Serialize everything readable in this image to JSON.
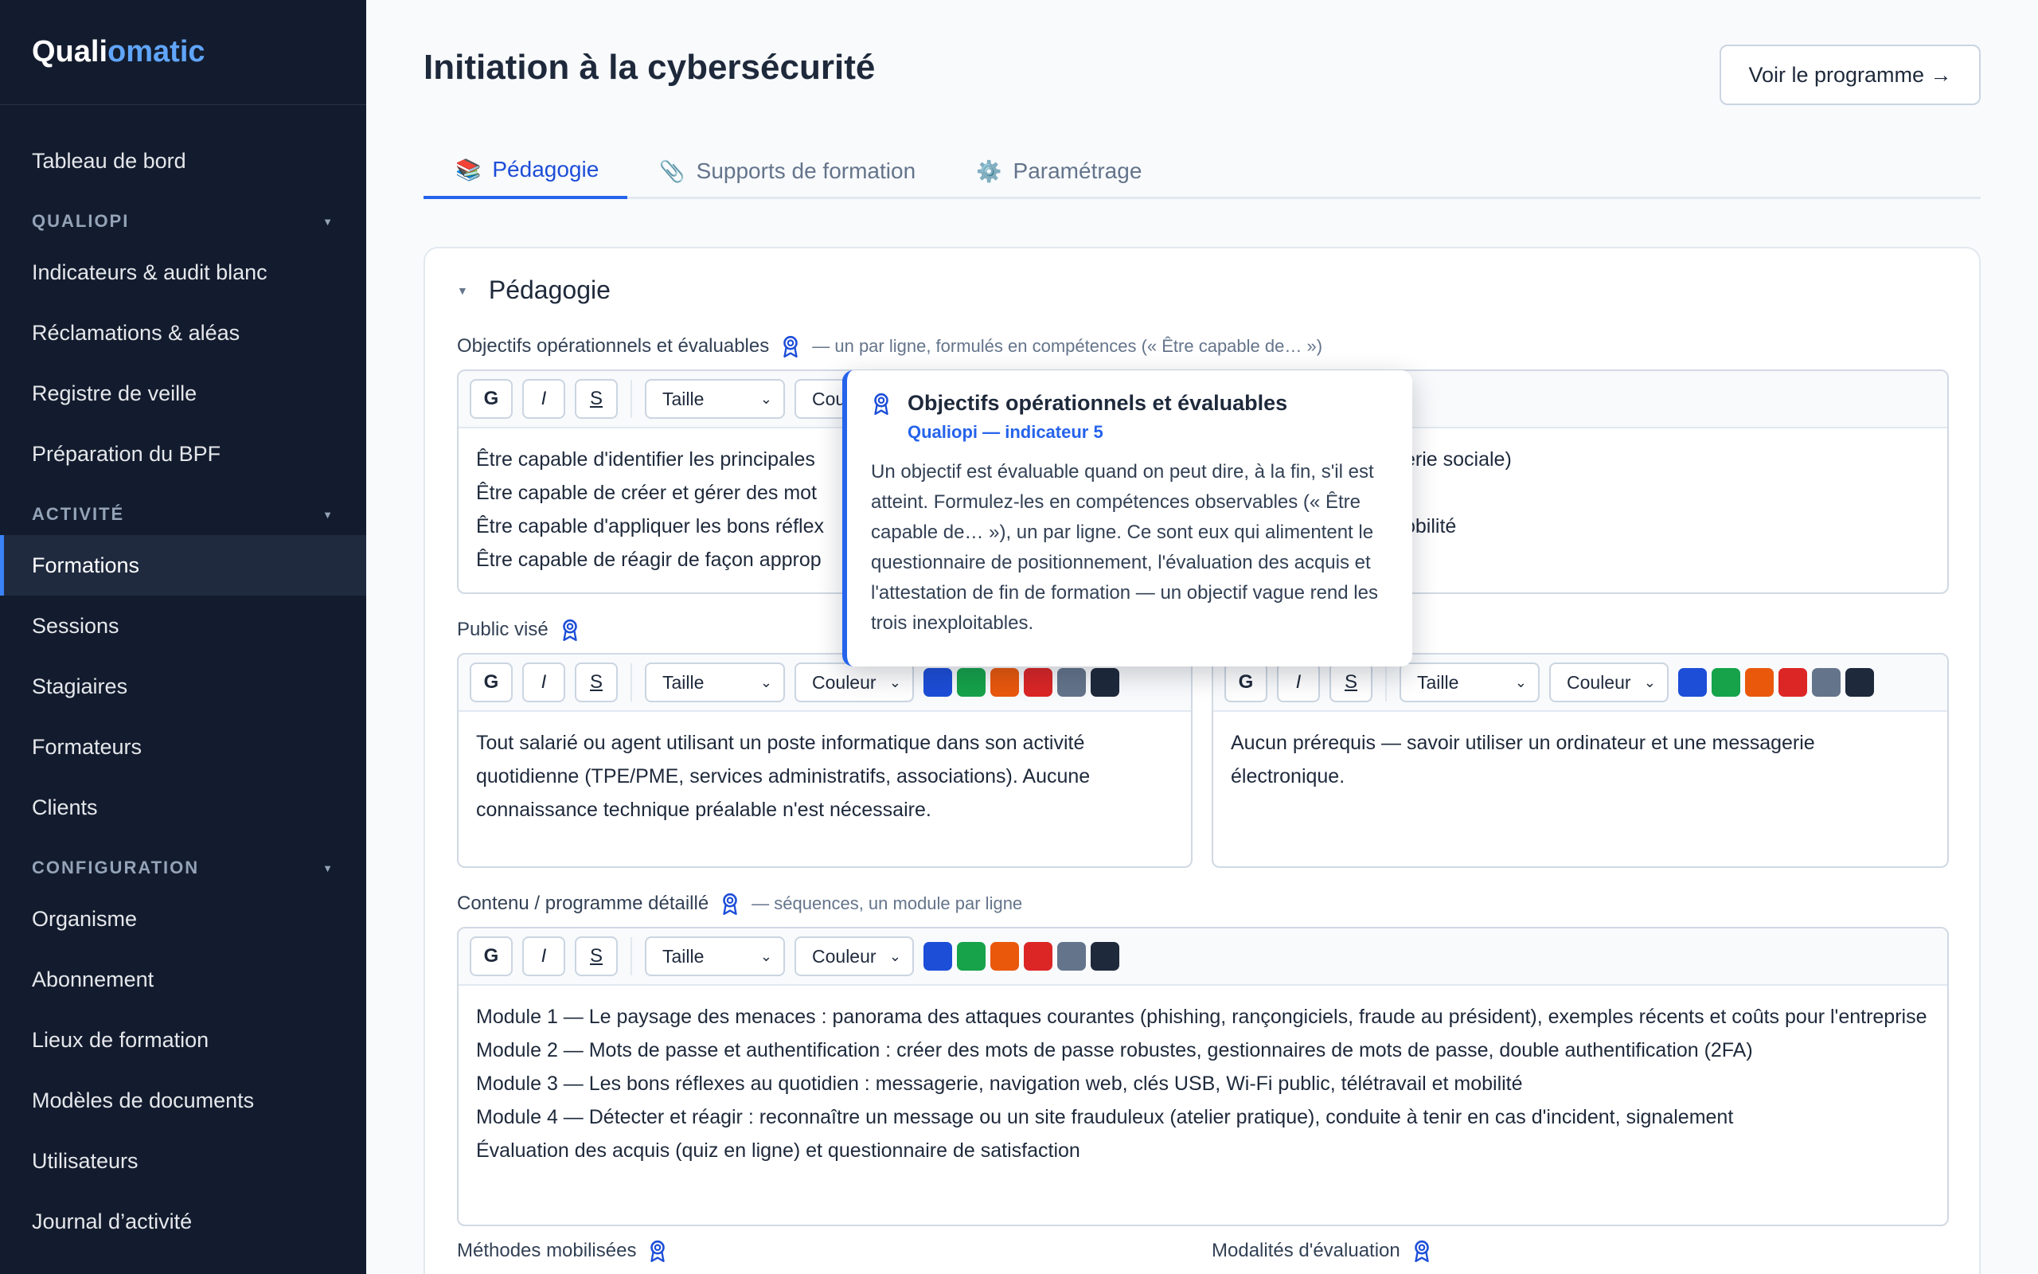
{
  "brand": {
    "part1": "Quali",
    "part2": "omatic"
  },
  "sidebar": {
    "top_item": "Tableau de bord",
    "sections": [
      {
        "title": "QUALIOPI",
        "items": [
          "Indicateurs & audit blanc",
          "Réclamations & aléas",
          "Registre de veille",
          "Préparation du BPF"
        ]
      },
      {
        "title": "ACTIVITÉ",
        "items": [
          "Formations",
          "Sessions",
          "Stagiaires",
          "Formateurs",
          "Clients"
        ]
      },
      {
        "title": "CONFIGURATION",
        "items": [
          "Organisme",
          "Abonnement",
          "Lieux de formation",
          "Modèles de documents",
          "Utilisateurs",
          "Journal d’activité"
        ]
      }
    ],
    "active_item": "Formations"
  },
  "page": {
    "title": "Initiation à la cybersécurité",
    "program_button": "Voir le programme →"
  },
  "tabs": [
    {
      "label": "Pédagogie",
      "icon": "books-icon",
      "active": true
    },
    {
      "label": "Supports de formation",
      "icon": "paperclip-icon",
      "active": false
    },
    {
      "label": "Paramétrage",
      "icon": "gear-icon",
      "active": false
    }
  ],
  "section": {
    "title": "Pédagogie"
  },
  "toolbar": {
    "bold": "G",
    "italic": "I",
    "strike": "S",
    "size_placeholder": "Taille",
    "color_placeholder": "Couleur",
    "swatches": [
      "#1d4ed8",
      "#16a34a",
      "#ea580c",
      "#dc2626",
      "#64748b",
      "#1e293b"
    ]
  },
  "fields": {
    "objectifs": {
      "label": "Objectifs opérationnels et évaluables",
      "hint": "— un par ligne, formulés en compétences (« Être capable de… »)",
      "lines": [
        "Être capable d'identifier les principales",
        "Être capable de créer et gérer des mot",
        "Être capable d'appliquer les bons réflex",
        "Être capable de réagir de façon approp"
      ],
      "lines_right": [
        "erie sociale)",
        "",
        "obilité",
        ""
      ],
      "toolbar_visible_partial": "Cou"
    },
    "public": {
      "label": "Public visé",
      "text": "Tout salarié ou agent utilisant un poste informatique dans son activité quotidienne (TPE/PME, services administratifs, associations). Aucune connaissance technique préalable n'est nécessaire."
    },
    "prerequis": {
      "text": "Aucun prérequis — savoir utiliser un ordinateur et une messagerie électronique."
    },
    "contenu": {
      "label": "Contenu / programme détaillé",
      "hint": "— séquences, un module par ligne",
      "lines": [
        "Module 1 — Le paysage des menaces : panorama des attaques courantes (phishing, rançongiciels, fraude au président), exemples récents et coûts pour l'entreprise",
        "Module 2 — Mots de passe et authentification : créer des mots de passe robustes, gestionnaires de mots de passe, double authentification (2FA)",
        "Module 3 — Les bons réflexes au quotidien : messagerie, navigation web, clés USB, Wi-Fi public, télétravail et mobilité",
        "Module 4 — Détecter et réagir : reconnaître un message ou un site frauduleux (atelier pratique), conduite à tenir en cas d'incident, signalement",
        "Évaluation des acquis (quiz en ligne) et questionnaire de satisfaction"
      ]
    },
    "methodes": {
      "label": "Méthodes mobilisées"
    },
    "modalites": {
      "label": "Modalités d'évaluation"
    }
  },
  "tooltip": {
    "title": "Objectifs opérationnels et évaluables",
    "subtitle": "Qualiopi — indicateur 5",
    "body": "Un objectif est évaluable quand on peut dire, à la fin, s'il est atteint. Formulez-les en compétences observables (« Être capable de… »), un par ligne. Ce sont eux qui alimentent le questionnaire de positionnement, l'évaluation des acquis et l'attestation de fin de formation — un objectif vague rend les trois inexploitables."
  }
}
